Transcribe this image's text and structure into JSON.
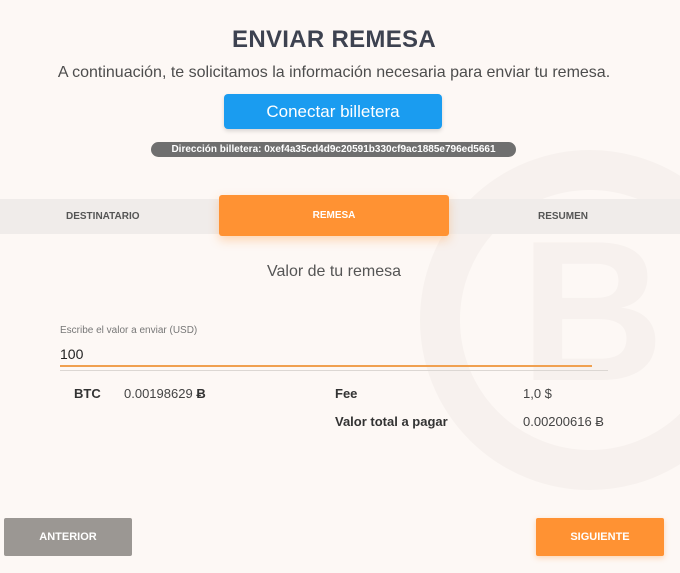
{
  "header": {
    "title": "ENVIAR REMESA",
    "subtitle": "A continuación, te solicitamos la información necesaria para enviar tu remesa.",
    "connect_label": "Conectar billetera",
    "wallet_label": "Dirección billetera: 0xef4a35cd4d9c20591b330cf9ac1885e796ed5661"
  },
  "steps": [
    {
      "label": "DESTINATARIO",
      "active": false
    },
    {
      "label": "REMESA",
      "active": true
    },
    {
      "label": "RESUMEN",
      "active": false
    }
  ],
  "form": {
    "section_title": "Valor de tu remesa",
    "amount_label": "Escribe el valor a enviar (USD)",
    "amount_value": "100"
  },
  "summary": {
    "btc_label": "BTC",
    "btc_value": "0.00198629",
    "btc_symbol": "Ƀ",
    "fee_label": "Fee",
    "fee_value": "1,0 $",
    "total_label": "Valor total a pagar",
    "total_value": "0.00200616 Ƀ"
  },
  "nav": {
    "prev_label": "ANTERIOR",
    "next_label": "SIGUIENTE"
  },
  "colors": {
    "accent": "#ff9233",
    "primary_button": "#1a9cf0",
    "secondary_button": "#9b9793"
  }
}
